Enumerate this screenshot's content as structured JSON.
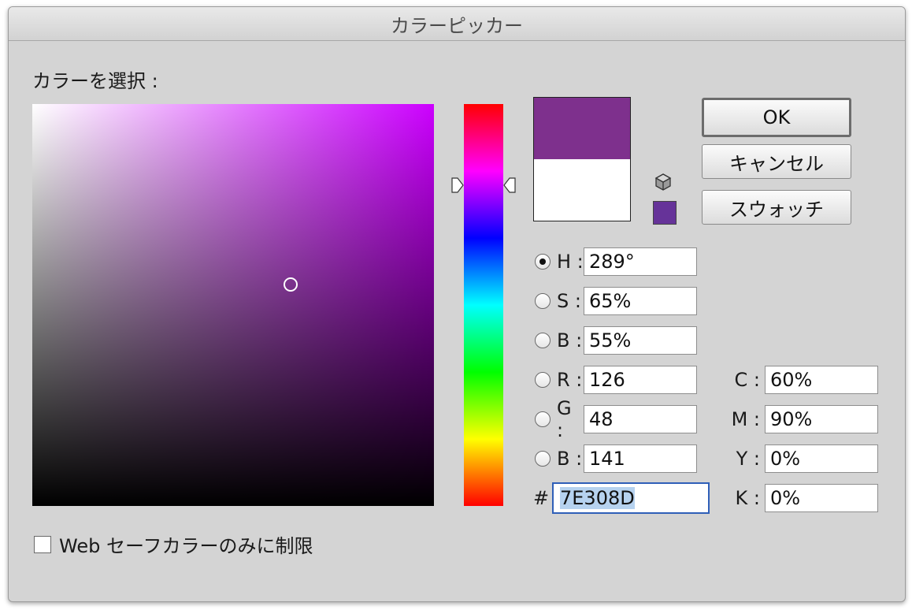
{
  "window": {
    "title": "カラーピッカー"
  },
  "picker": {
    "select_label": "カラーを選択 :"
  },
  "colors": {
    "new": "#7E308D",
    "old": "#FFFFFF",
    "web_safe": "#663399"
  },
  "buttons": {
    "ok": "OK",
    "cancel": "キャンセル",
    "swatches": "スウォッチ"
  },
  "hsb": [
    {
      "label": "H :",
      "value": "289°",
      "selected": true
    },
    {
      "label": "S :",
      "value": "65%",
      "selected": false
    },
    {
      "label": "B :",
      "value": "55%",
      "selected": false
    }
  ],
  "rgb": [
    {
      "label": "R :",
      "value": "126",
      "selected": false
    },
    {
      "label": "G :",
      "value": "48",
      "selected": false
    },
    {
      "label": "B :",
      "value": "141",
      "selected": false
    }
  ],
  "hex": {
    "label": "#",
    "value": "7E308D"
  },
  "cmyk": [
    {
      "label": "C :",
      "value": "60%"
    },
    {
      "label": "M :",
      "value": "90%"
    },
    {
      "label": "Y :",
      "value": "0%"
    },
    {
      "label": "K :",
      "value": "0%"
    }
  ],
  "web_only": {
    "label": "Web セーフカラーのみに制限",
    "checked": false
  },
  "icons": {
    "cube": "gamut-warning-cube-icon"
  }
}
